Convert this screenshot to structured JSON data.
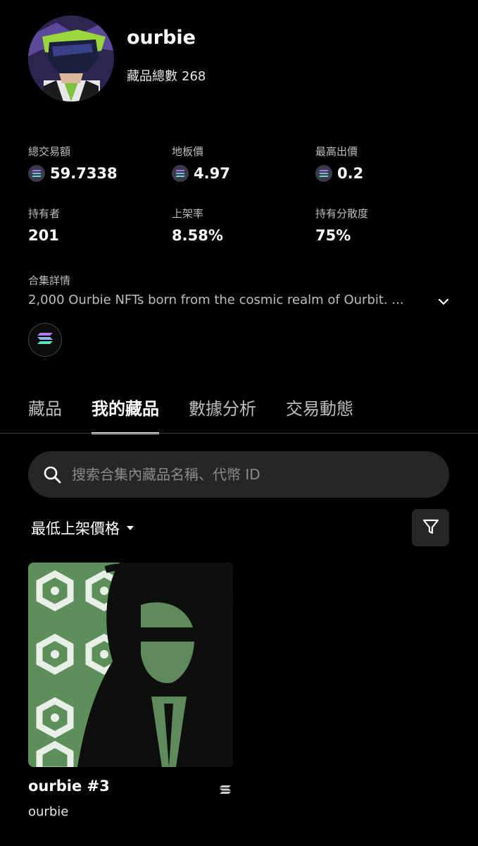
{
  "collection": {
    "name": "ourbie",
    "item_count_label": "藏品總數",
    "item_count": "268"
  },
  "stats": [
    {
      "label": "總交易額",
      "value": "59.7338",
      "has_sol_icon": true
    },
    {
      "label": "地板價",
      "value": "4.97",
      "has_sol_icon": true
    },
    {
      "label": "最高出價",
      "value": "0.2",
      "has_sol_icon": true
    },
    {
      "label": "持有者",
      "value": "201",
      "has_sol_icon": false
    },
    {
      "label": "上架率",
      "value": "8.58%",
      "has_sol_icon": false
    },
    {
      "label": "持有分散度",
      "value": "75%",
      "has_sol_icon": false
    }
  ],
  "details": {
    "label": "合集詳情",
    "text": "2,000 Ourbie NFTs born from the cosmic realm of Ourbit. ..."
  },
  "tabs": [
    {
      "label": "藏品",
      "active": false
    },
    {
      "label": "我的藏品",
      "active": true
    },
    {
      "label": "數據分析",
      "active": false
    },
    {
      "label": "交易動態",
      "active": false
    }
  ],
  "search": {
    "placeholder": "搜索合集內藏品名稱、代幣 ID"
  },
  "sort": {
    "label": "最低上架價格"
  },
  "nft": {
    "name": "ourbie #3",
    "collection": "ourbie"
  },
  "colors": {
    "background": "#000000",
    "surface": "#262626",
    "muted_text": "#bdbdbd",
    "nft_green": "#5a8a5a"
  },
  "icons": {
    "search": "search-icon",
    "filter": "filter-icon",
    "chevron": "chevron-down-icon",
    "chain": "solana-icon"
  }
}
